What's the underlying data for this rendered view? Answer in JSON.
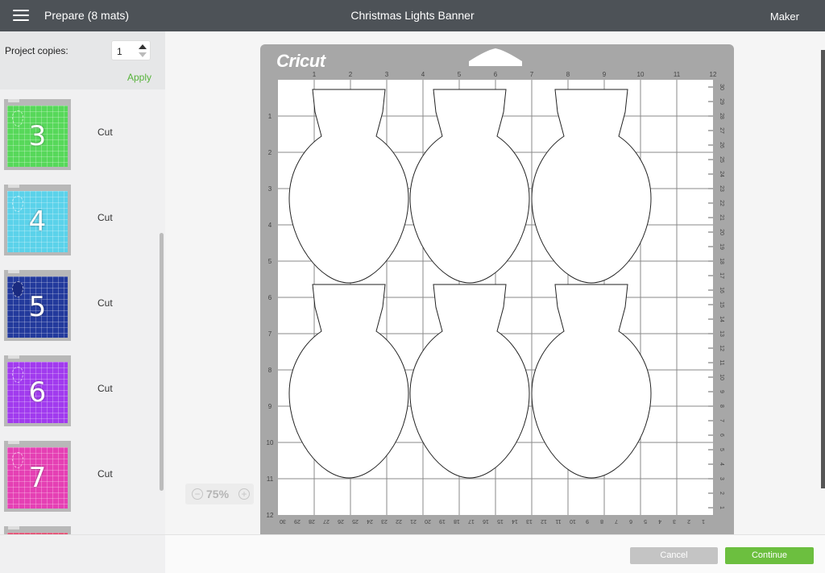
{
  "header": {
    "menu_label": "Prepare (8 mats)",
    "title": "Christmas Lights Banner",
    "machine": "Maker"
  },
  "sidebar": {
    "copies_label": "Project copies:",
    "copies_value": "1",
    "apply_label": "Apply",
    "mats": [
      {
        "number": "3",
        "action": "Cut",
        "color": "#57d85a"
      },
      {
        "number": "4",
        "action": "Cut",
        "color": "#5bd2ea"
      },
      {
        "number": "5",
        "action": "Cut",
        "color": "#233a9c"
      },
      {
        "number": "6",
        "action": "Cut",
        "color": "#a13bee"
      },
      {
        "number": "7",
        "action": "Cut",
        "color": "#e540b4"
      }
    ]
  },
  "canvas": {
    "logo": "Cricut",
    "zoom_level": "75%",
    "zoom_out_label": "−",
    "zoom_in_label": "+",
    "top_ruler": [
      "1",
      "2",
      "3",
      "4",
      "5",
      "6",
      "7",
      "8",
      "9",
      "10",
      "11",
      "12"
    ],
    "left_ruler": [
      "1",
      "2",
      "3",
      "4",
      "5",
      "6",
      "7",
      "8",
      "9",
      "10",
      "11",
      "12"
    ],
    "bottom_ruler": [
      "30",
      "29",
      "28",
      "27",
      "26",
      "25",
      "24",
      "23",
      "22",
      "21",
      "20",
      "19",
      "18",
      "17",
      "16",
      "15",
      "14",
      "13",
      "12",
      "11",
      "10",
      "9",
      "8",
      "7",
      "6",
      "5",
      "4",
      "3",
      "2",
      "1"
    ],
    "right_ruler": [
      "30",
      "29",
      "28",
      "27",
      "26",
      "25",
      "24",
      "23",
      "22",
      "21",
      "20",
      "19",
      "18",
      "17",
      "16",
      "15",
      "14",
      "13",
      "12",
      "11",
      "10",
      "9",
      "8",
      "7",
      "6",
      "5",
      "4",
      "3",
      "2",
      "1"
    ]
  },
  "footer": {
    "cancel_label": "Cancel",
    "continue_label": "Continue"
  },
  "colors": {
    "header_bg": "#4d5257",
    "accent_green": "#6cbf3f",
    "mat_gray": "#a7a7a7"
  }
}
